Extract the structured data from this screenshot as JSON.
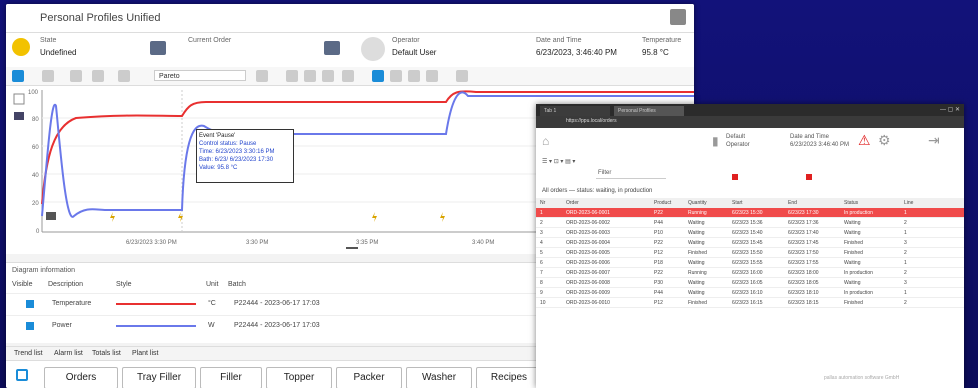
{
  "window1": {
    "title": "Personal Profiles Unified",
    "status": {
      "state_label": "State",
      "state_value": "Undefined",
      "order_label": "Current Order",
      "operator_label": "Operator",
      "operator_value": "Default User",
      "time_label": "Date and Time",
      "time_value": "6/23/2023, 3:46:40 PM",
      "temp_label": "Temperature",
      "temp_value": "95.8 °C"
    },
    "toolbar": {
      "select_value": "Pareto"
    },
    "chart": {
      "x_ticks": [
        "6/23/2023 3:30 PM",
        "3:30 PM",
        "3:35 PM",
        "3:40 PM"
      ],
      "y_ticks": [
        "100",
        "80",
        "60",
        "40",
        "20",
        "0"
      ]
    },
    "tooltip": {
      "line1": "Event 'Pause'",
      "line2": "Control status: Pause",
      "line3": "Time: 6/23/2023 3:30:16 PM",
      "line4": "Bath: 6/23/ 6/23/2023 17:30",
      "line5": "Value: 95.8 °C"
    },
    "legend": {
      "title": "Diagram information",
      "headers": [
        "Visible",
        "Description",
        "Style",
        "Unit",
        "Batch"
      ],
      "rows": [
        {
          "name": "Temperature",
          "unit": "°C",
          "batch": "P22444 - 2023-06-17 17:03"
        },
        {
          "name": "Power",
          "unit": "W",
          "batch": "P22444 - 2023-06-17 17:03"
        }
      ]
    },
    "tabs": [
      "Trend list",
      "Alarm list",
      "Totals list",
      "Plant list"
    ],
    "buttons": [
      "Orders",
      "Tray Filler",
      "Filler",
      "Topper",
      "Packer",
      "Washer",
      "Recipes"
    ]
  },
  "window2": {
    "tab1": "Tab 1",
    "tab2": "Personal Profiles",
    "url": "https://ppu.local/orders",
    "user_label": "Default",
    "user_value": "Operator",
    "date_label": "Date and Time",
    "date_value": "6/23/2023 3:46:40 PM",
    "filter_value": "Filter",
    "grid_title": "All orders — status: waiting, in production",
    "columns": [
      "Nr",
      "Order",
      "Product",
      "Quantity",
      "Start",
      "End",
      "Status",
      "Line"
    ],
    "rows": [
      [
        "1",
        "ORD-2023-06-0001",
        "P22",
        "Running",
        "6/23/23 15:30",
        "6/23/23 17:30",
        "In production",
        "1"
      ],
      [
        "2",
        "ORD-2023-06-0002",
        "P44",
        "Waiting",
        "6/23/23 15:36",
        "6/23/23 17:36",
        "Waiting",
        "2"
      ],
      [
        "3",
        "ORD-2023-06-0003",
        "P10",
        "Waiting",
        "6/23/23 15:40",
        "6/23/23 17:40",
        "Waiting",
        "1"
      ],
      [
        "4",
        "ORD-2023-06-0004",
        "P22",
        "Waiting",
        "6/23/23 15:45",
        "6/23/23 17:45",
        "Finished",
        "3"
      ],
      [
        "5",
        "ORD-2023-06-0005",
        "P12",
        "Finished",
        "6/23/23 15:50",
        "6/23/23 17:50",
        "Finished",
        "2"
      ],
      [
        "6",
        "ORD-2023-06-0006",
        "P18",
        "Waiting",
        "6/23/23 15:55",
        "6/23/23 17:55",
        "Waiting",
        "1"
      ],
      [
        "7",
        "ORD-2023-06-0007",
        "P22",
        "Running",
        "6/23/23 16:00",
        "6/23/23 18:00",
        "In production",
        "2"
      ],
      [
        "8",
        "ORD-2023-06-0008",
        "P30",
        "Waiting",
        "6/23/23 16:05",
        "6/23/23 18:05",
        "Waiting",
        "3"
      ],
      [
        "9",
        "ORD-2023-06-0009",
        "P44",
        "Waiting",
        "6/23/23 16:10",
        "6/23/23 18:10",
        "In production",
        "1"
      ],
      [
        "10",
        "ORD-2023-06-0010",
        "P12",
        "Finished",
        "6/23/23 16:15",
        "6/23/23 18:15",
        "Finished",
        "2"
      ]
    ],
    "footer": "pallas automation software GmbH"
  },
  "colors": {
    "red": "#e83030",
    "blue": "#6a78ea",
    "accent": "#1a8cd8",
    "highlight": "#f04b4b"
  }
}
